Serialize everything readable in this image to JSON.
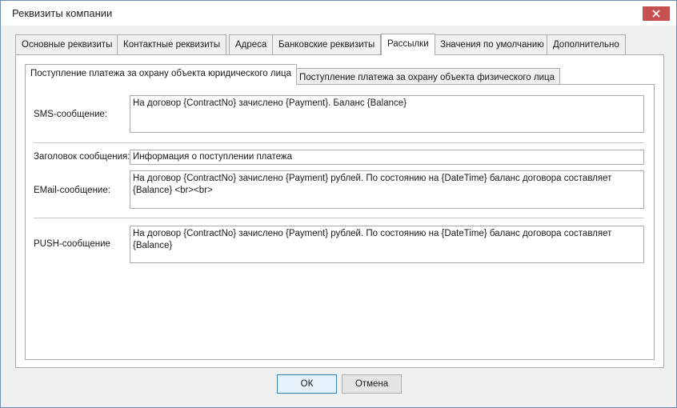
{
  "window": {
    "title": "Реквизиты компании"
  },
  "tabs": [
    {
      "label": "Основные реквизиты",
      "active": false
    },
    {
      "label": "Контактные реквизиты",
      "active": false
    },
    {
      "label": "Адреса",
      "active": false
    },
    {
      "label": "Банковские реквизиты",
      "active": false
    },
    {
      "label": "Рассылки",
      "active": true
    },
    {
      "label": "Значения по умолчанию",
      "active": false
    },
    {
      "label": "Дополнительно",
      "active": false
    }
  ],
  "subtabs": [
    {
      "label": "Поступление платежа за охрану объекта юридического лица",
      "active": true
    },
    {
      "label": "Поступление платежа за охрану объекта физического лица",
      "active": false
    }
  ],
  "form": {
    "sms_label": "SMS-сообщение:",
    "sms_value": "На договор {ContractNo} зачислено {Payment}. Баланс {Balance}",
    "subject_label": "Заголовок сообщения:",
    "subject_value": "Информация о поступлении платежа",
    "email_label": "EMail-сообщение:",
    "email_value": "На договор {ContractNo} зачислено {Payment} рублей. По состоянию на {DateTime} баланс договора составляет {Balance} <br><br>",
    "push_label": "PUSH-сообщение",
    "push_value": "На договор {ContractNo} зачислено {Payment} рублей. По состоянию на {DateTime} баланс договора составляет {Balance}"
  },
  "buttons": {
    "ok_label": "ОК",
    "cancel_label": "Отмена"
  },
  "colors": {
    "close_button": "#c75050",
    "window_border": "#6c8fb8"
  },
  "icons": {
    "close": "close-icon"
  }
}
